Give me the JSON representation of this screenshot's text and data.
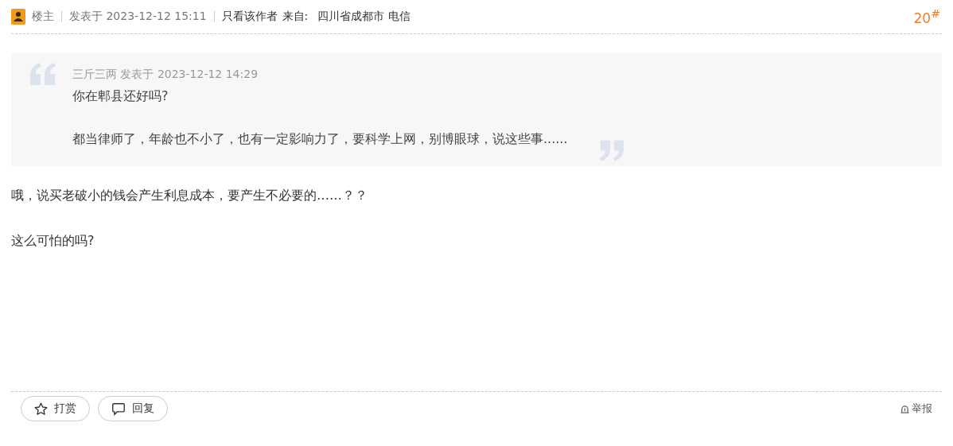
{
  "post_header": {
    "role": "楼主",
    "posted": "发表于 2023-12-12 15:11",
    "author_only": "只看该作者",
    "from_label": "来自:",
    "location": "四川省成都市 电信",
    "floor": "20$^{#}$"
  },
  "quote": {
    "meta": "三斤三两 发表于 2023-12-12 14:29",
    "lines": [
      "你在郫县还好吗?",
      "都当律师了，年龄也不小了，也有一定影响力了，要科学上网，别博眼球，说这些事......"
    ]
  },
  "body": [
    "哦，说买老破小的钱会产生利息成本，要产生不必要的……？？",
    "这么可怕的吗?"
  ],
  "actions": [
    {
      "kind": "reward",
      "label": "打赏"
    },
    {
      "kind": "reply",
      "label": "回复"
    }
  ],
  "report": "举报"
}
